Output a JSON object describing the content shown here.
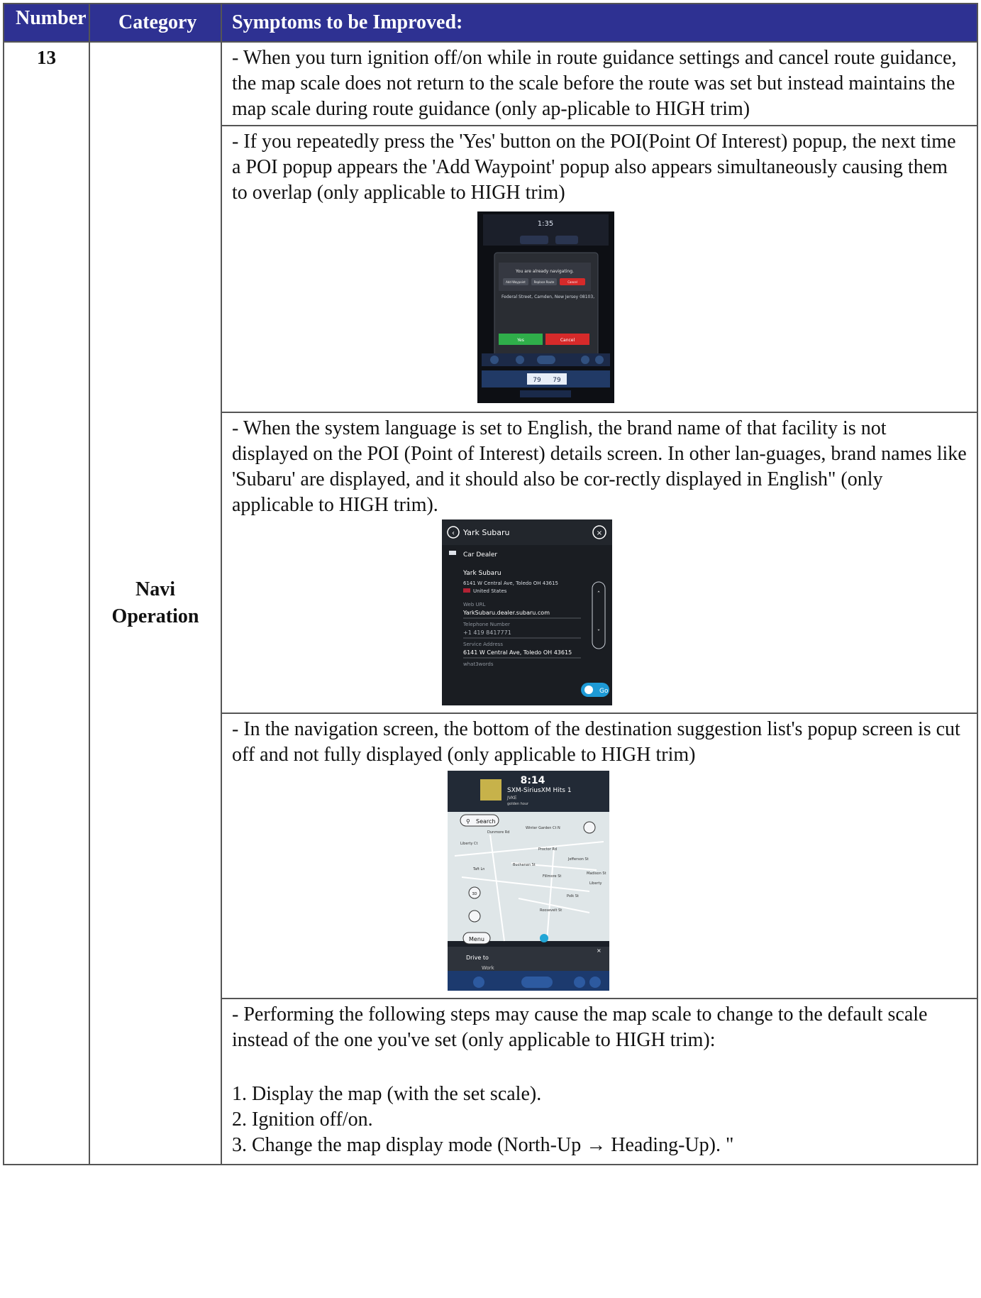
{
  "headers": {
    "number": "Number",
    "category": "Category",
    "symptoms": "Symptoms to be Improved:"
  },
  "row": {
    "number": "13",
    "category_line1": "Navi",
    "category_line2": "Operation"
  },
  "symptoms": [
    "- When you turn ignition off/on while in route guidance settings and cancel route guidance, the map scale does not return to the scale before the route was set but instead maintains the map scale during route guidance (only ap-plicable to HIGH trim)",
    "- If you repeatedly press the 'Yes' button on the POI(Point Of Interest) popup, the next time a POI popup appears the 'Add Waypoint' popup also appears simultaneously causing them to overlap (only applicable to HIGH trim)",
    "- When the system language is set to English, the brand name of that facility is not displayed on the POI (Point of Interest) details screen. In other lan-guages, brand names like 'Subaru' are displayed, and it should also be cor-rectly displayed in English\" (only applicable to HIGH trim).",
    "- In the navigation screen, the bottom of the destination suggestion list's popup screen is cut off and not fully displayed (only applicable to HIGH trim)",
    "- Performing the following steps may cause the map scale to change to the default scale instead of the one you've set (only applicable to HIGH trim):"
  ],
  "steps": [
    "1. Display the map (with the set scale).",
    "2. Ignition off/on.",
    "3. Change the map display mode (North-Up → Heading-Up). \""
  ],
  "shot1": {
    "time": "1:35",
    "popup_text": "You are already navigating.",
    "btn_add": "Add Waypoint",
    "btn_replace": "Replace Route",
    "btn_cancel_top": "Cancel",
    "address": "Federal Street, Camden, New Jersey 08103,",
    "btn_yes": "Yes",
    "btn_cancel": "Cancel",
    "temp_left": "79",
    "temp_right": "79"
  },
  "shot2": {
    "title": "Yark Subaru",
    "category": "Car Dealer",
    "name": "Yark Subaru",
    "address": "6141 W Central Ave, Toledo OH 43615",
    "country": "United States",
    "weburl_label": "Web URL",
    "weburl": "YarkSubaru.dealer.subaru.com",
    "phone_label": "Telephone Number",
    "phone": "+1 419 8417771",
    "service_label": "Service Address",
    "service": "6141 W Central Ave, Toledo OH 43615",
    "w3w_label": "what3words",
    "go": "Go"
  },
  "shot3": {
    "time": "8:14",
    "station": "SXM-SiriusXM Hits 1",
    "artist": "JVKE",
    "song": "golden hour",
    "search": "Search",
    "menu": "Menu",
    "drive_to": "Drive to",
    "work": "Work",
    "streets": [
      "Winter Garden Ct N",
      "Dunmore Rd",
      "Liberty Ct",
      "Proctor Rd",
      "Taft Ln",
      "Buchanan St",
      "Jefferson St",
      "Fillmore St",
      "Madison St",
      "Polk St",
      "Roosevelt St",
      "Liberty"
    ],
    "btn_3d": "3D"
  },
  "colors": {
    "header_bg": "#2e3192",
    "border": "#555555"
  }
}
